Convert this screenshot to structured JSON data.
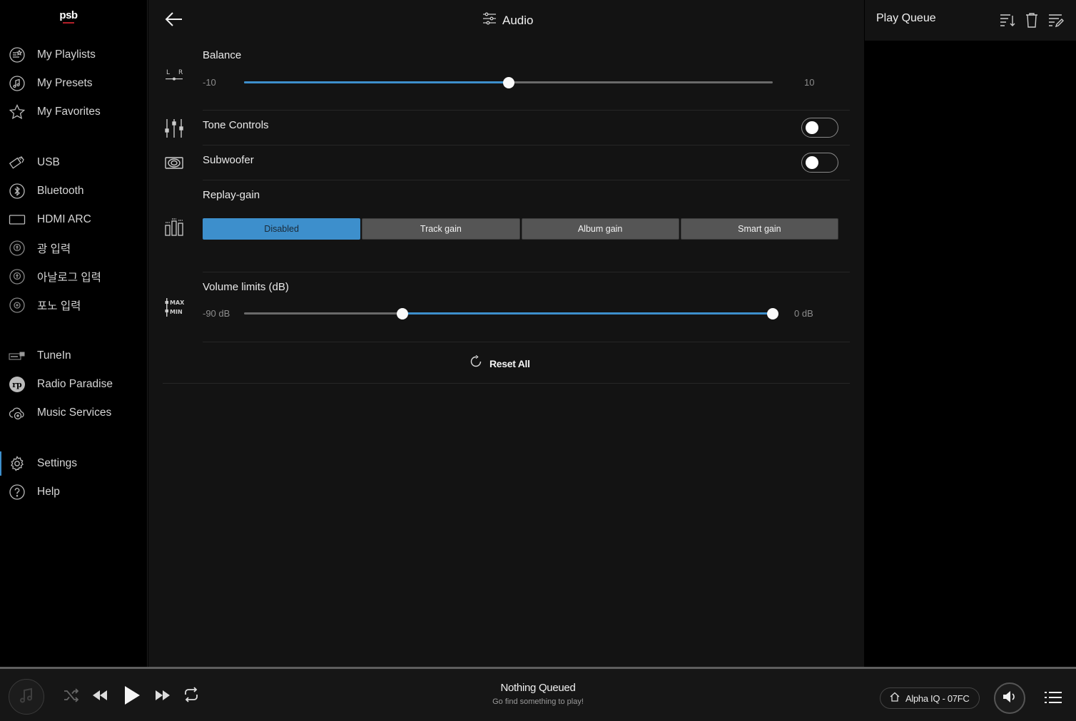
{
  "app": {
    "logo_text": "psb"
  },
  "sidebar": {
    "items": [
      {
        "label": "My Playlists",
        "icon": "playlist-star-icon"
      },
      {
        "label": "My Presets",
        "icon": "music-note-circle-icon"
      },
      {
        "label": "My Favorites",
        "icon": "star-icon"
      },
      {
        "label": "USB",
        "icon": "usb-icon"
      },
      {
        "label": "Bluetooth",
        "icon": "bluetooth-icon"
      },
      {
        "label": "HDMI ARC",
        "icon": "hdmi-icon"
      },
      {
        "label": "광 입력",
        "icon": "optical-input-icon"
      },
      {
        "label": "아날로그 입력",
        "icon": "analog-input-icon"
      },
      {
        "label": "포노 입력",
        "icon": "phono-input-icon"
      },
      {
        "label": "TuneIn",
        "icon": "tunein-icon"
      },
      {
        "label": "Radio Paradise",
        "icon": "radio-paradise-icon"
      },
      {
        "label": "Music Services",
        "icon": "cloud-plus-icon"
      },
      {
        "label": "Settings",
        "icon": "gear-icon",
        "active": true
      },
      {
        "label": "Help",
        "icon": "help-icon"
      }
    ]
  },
  "header": {
    "title": "Audio"
  },
  "balance": {
    "label": "Balance",
    "min_label": "-10",
    "max_label": "10",
    "min": -10,
    "max": 10,
    "value": 0
  },
  "tone_controls": {
    "label": "Tone Controls",
    "enabled": false
  },
  "subwoofer": {
    "label": "Subwoofer",
    "enabled": false
  },
  "replay_gain": {
    "label": "Replay-gain",
    "options": [
      "Disabled",
      "Track gain",
      "Album gain",
      "Smart gain"
    ],
    "selected": "Disabled"
  },
  "volume_limits": {
    "label": "Volume limits (dB)",
    "min_label": "-90 dB",
    "max_label": "0 dB",
    "icon_max": "MAX",
    "icon_min": "MIN",
    "range": [
      -90,
      0
    ],
    "low": -63,
    "high": 0
  },
  "reset": {
    "label": "Reset All"
  },
  "queue": {
    "title": "Play Queue"
  },
  "player": {
    "title": "Nothing Queued",
    "subtitle": "Go find something to play!",
    "device": "Alpha IQ - 07FC"
  },
  "colors": {
    "accent": "#3d8fcc",
    "background": "#131313",
    "sidebar": "#000000"
  }
}
